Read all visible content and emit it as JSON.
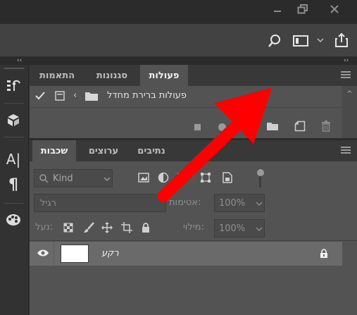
{
  "window": {
    "minimize_icon": "minimize-icon",
    "restore_icon": "restore-icon",
    "close_icon": "close-icon"
  },
  "appbar": {
    "search_icon": "search-icon",
    "workspace_icon": "workspace-icon",
    "share_icon": "share-icon"
  },
  "actions_panel": {
    "tabs": [
      "פעולות",
      "סגנונות",
      "התאמות"
    ],
    "action_row": {
      "label": "פעולות ברירת מחדל",
      "checked": true
    },
    "footer_icons": [
      "stop-icon",
      "record-icon",
      "play-icon",
      "new-set-icon",
      "new-action-icon",
      "delete-icon"
    ]
  },
  "layers_panel": {
    "tabs": [
      "שכבות",
      "ערוצים",
      "נתיבים"
    ],
    "filter": {
      "kind": "Kind"
    },
    "blend_mode": "רגיל",
    "opacity": {
      "label": "אטימות:",
      "value": "100%"
    },
    "lock": {
      "label": "נעל:"
    },
    "fill": {
      "label": "מילוי:",
      "value": "100%"
    },
    "layers": [
      {
        "name": "רקע",
        "visible": true,
        "locked": true
      }
    ]
  },
  "annotation": {
    "color": "#ff0000"
  },
  "colors": {
    "bg": "#323232",
    "panel": "#535353",
    "tab_bar": "#383838",
    "selected_layer": "#6a6a6a"
  }
}
